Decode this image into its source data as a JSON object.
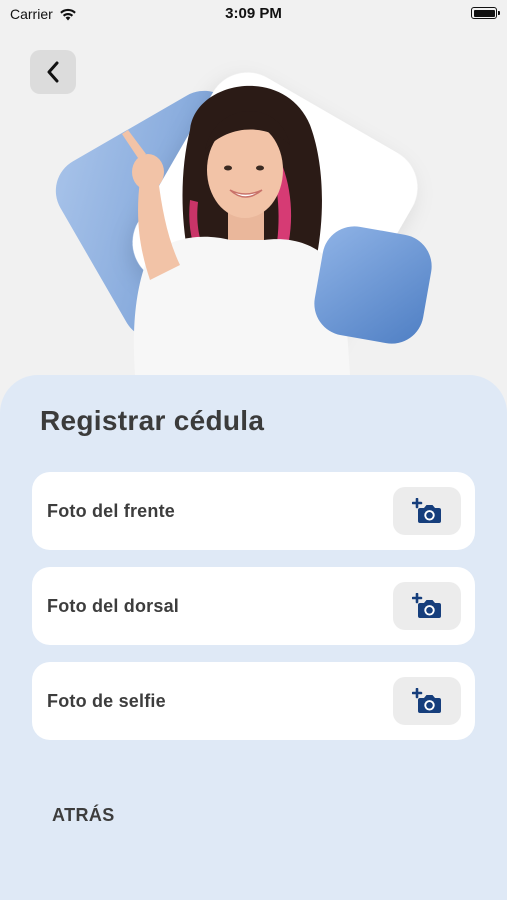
{
  "status_bar": {
    "carrier": "Carrier",
    "time": "3:09 PM",
    "wifi_icon": "wifi-icon",
    "battery_icon": "battery-icon"
  },
  "nav": {
    "back_icon": "chevron-left-icon"
  },
  "hero": {
    "illustration": "woman-pointing-illustration",
    "accent_color": "#7fa6da"
  },
  "main": {
    "title": "Registrar cédula",
    "rows": [
      {
        "label": "Foto del frente",
        "icon": "add-camera-icon"
      },
      {
        "label": "Foto del dorsal",
        "icon": "add-camera-icon"
      },
      {
        "label": "Foto de selfie",
        "icon": "add-camera-icon"
      }
    ],
    "back_label": "ATRÁS"
  },
  "colors": {
    "background": "#f1f1f1",
    "panel": "#dfe9f6",
    "camera_icon": "#163e7c",
    "text": "#3b3b3b"
  }
}
